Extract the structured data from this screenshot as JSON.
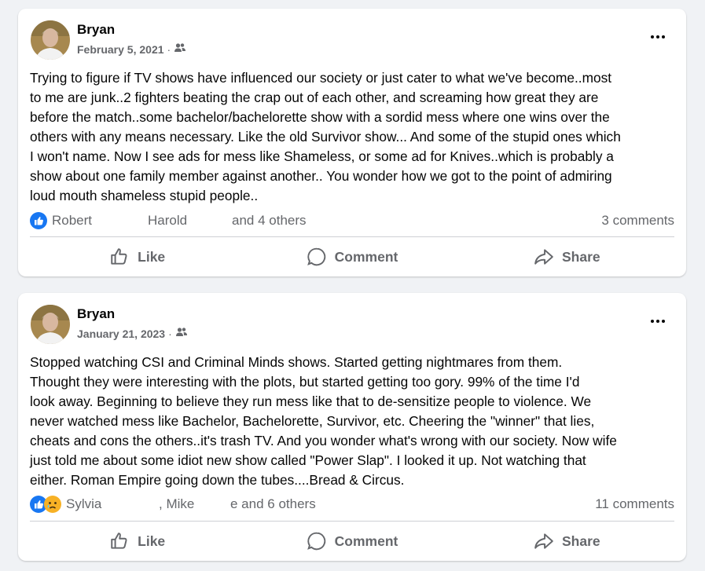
{
  "posts": [
    {
      "author": "Bryan",
      "date": "February 5, 2021",
      "separator": "·",
      "audience_icon": "friends-icon",
      "text": "Trying to figure if TV shows have influenced our society or just cater to what we've become..most\nto me are junk..2 fighters beating the crap out of each other, and screaming how great they are\nbefore the match..some bachelor/bachelorette show with a sordid mess where one wins over the\nothers with any means necessary.  Like the old Survivor show... And some of the stupid ones which\nI won't name.  Now I see ads for mess like Shameless, or some ad for Knives..which is probably a\nshow about one family member against another.. You wonder how we got to the point of admiring\nloud mouth shameless stupid people..",
      "reaction_icons": [
        "like-reaction-icon"
      ],
      "reactors": [
        "Robert",
        "Harold",
        "and 4 others"
      ],
      "comments": "3 comments"
    },
    {
      "author": "Bryan",
      "date": "January 21, 2023",
      "separator": "·",
      "audience_icon": "friends-icon",
      "text": "Stopped watching CSI and Criminal Minds shows.  Started getting nightmares from them.\nThought they were interesting with the plots, but started getting too gory.  99% of the time I'd\nlook away.  Beginning to believe they run mess like that to de-sensitize people to violence.   We\nnever watched mess like Bachelor, Bachelorette, Survivor, etc.  Cheering the \"winner\" that lies,\ncheats and cons the others..it's trash TV. And you wonder what's wrong with our society. Now wife\njust told me about some idiot new show called \"Power Slap\".   I looked it up.  Not watching that\neither.   Roman Empire going down the tubes....Bread & Circus.",
      "reaction_icons": [
        "like-reaction-icon",
        "sad-reaction-icon"
      ],
      "reactors": [
        "Sylvia",
        ", Mike",
        "e and 6 others"
      ],
      "comments": "11 comments"
    }
  ],
  "actions": {
    "like": "Like",
    "comment": "Comment",
    "share": "Share"
  },
  "colors": {
    "page_bg": "#f0f2f5",
    "card_bg": "#ffffff",
    "secondary_text": "#65676b",
    "like_blue": "#1877f2",
    "sad_yellow": "#f7b125"
  }
}
